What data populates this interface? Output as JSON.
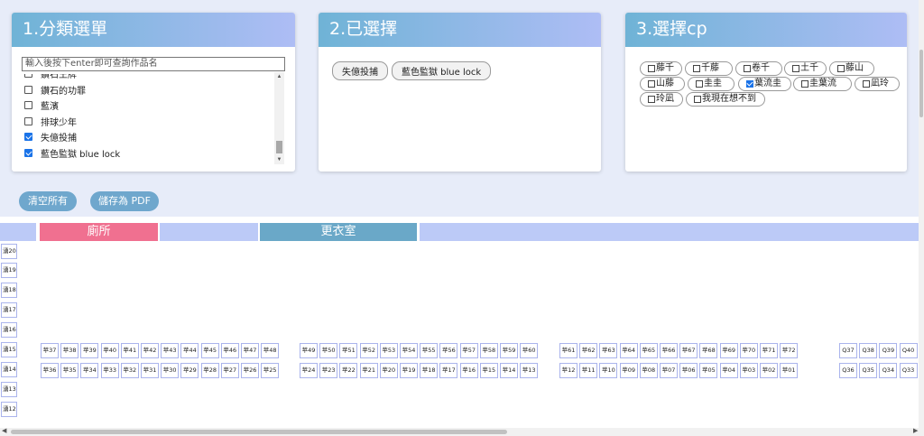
{
  "panels": {
    "category": {
      "title": "1.分類選單",
      "search_placeholder": "輸入後按下enter即可查詢作品名",
      "items": [
        {
          "label": "鑽石王牌",
          "checked": false
        },
        {
          "label": "鑽石的功罪",
          "checked": false
        },
        {
          "label": "藍濱",
          "checked": false
        },
        {
          "label": "排球少年",
          "checked": false
        },
        {
          "label": "失億投捕",
          "checked": true
        },
        {
          "label": "藍色監獄 blue lock",
          "checked": true
        }
      ]
    },
    "selected": {
      "title": "2.已選擇",
      "chips": [
        "失億投捕",
        "藍色監獄 blue lock"
      ]
    },
    "cp": {
      "title": "3.選擇cp",
      "items": [
        {
          "label": "藤千",
          "checked": false
        },
        {
          "label": "千藤",
          "checked": false
        },
        {
          "label": "卷千",
          "checked": false
        },
        {
          "label": "土千",
          "checked": false
        },
        {
          "label": "藤山",
          "checked": false
        },
        {
          "label": "山藤",
          "checked": false
        },
        {
          "label": "圭圭",
          "checked": false
        },
        {
          "label": "葉流圭",
          "checked": true
        },
        {
          "label": "圭葉流",
          "checked": false
        },
        {
          "label": "凪玲",
          "checked": false
        },
        {
          "label": "玲凪",
          "checked": false
        },
        {
          "label": "我現在想不到",
          "checked": false
        }
      ]
    }
  },
  "buttons": {
    "clear": "清空所有",
    "save_pdf": "儲存為 PDF"
  },
  "map": {
    "zones": {
      "restroom": "廁所",
      "locker_room": "更衣室"
    },
    "colors": {
      "restroom": "#f07090",
      "locker_room": "#6aa8c8",
      "plain": "#bccaf7"
    },
    "row_labels": [
      "湧20",
      "湧19",
      "湧18",
      "湧17",
      "湧16",
      "湧15",
      "湧14",
      "湧13",
      "湧12"
    ],
    "row15_label": "湧15",
    "row14_label": "湧14",
    "row15_groups": [
      [
        "苹37",
        "苹38",
        "苹39",
        "苹40",
        "苹41",
        "苹42",
        "苹43",
        "苹44",
        "苹45",
        "苹46",
        "苹47",
        "苹48"
      ],
      [
        "苹49",
        "苹50",
        "苹51",
        "苹52",
        "苹53",
        "苹54",
        "苹55",
        "苹56",
        "苹57",
        "苹58",
        "苹59",
        "苹60"
      ],
      [
        "苹61",
        "苹62",
        "苹63",
        "苹64",
        "苹65",
        "苹66",
        "苹67",
        "苹68",
        "苹69",
        "苹70",
        "苹71",
        "苹72"
      ],
      [
        "Q37",
        "Q38",
        "Q39",
        "Q40"
      ]
    ],
    "row14_groups": [
      [
        "苹36",
        "苹35",
        "苹34",
        "苹33",
        "苹32",
        "苹31",
        "苹30",
        "苹29",
        "苹28",
        "苹27",
        "苹26",
        "苹25"
      ],
      [
        "苹24",
        "苹23",
        "苹22",
        "苹21",
        "苹20",
        "苹19",
        "苹18",
        "苹17",
        "苹16",
        "苹15",
        "苹14",
        "苹13"
      ],
      [
        "苹12",
        "苹11",
        "苹10",
        "苹09",
        "苹08",
        "苹07",
        "苹06",
        "苹05",
        "苹04",
        "苹03",
        "苹02",
        "苹01"
      ],
      [
        "Q36",
        "Q35",
        "Q34",
        "Q33"
      ]
    ]
  }
}
